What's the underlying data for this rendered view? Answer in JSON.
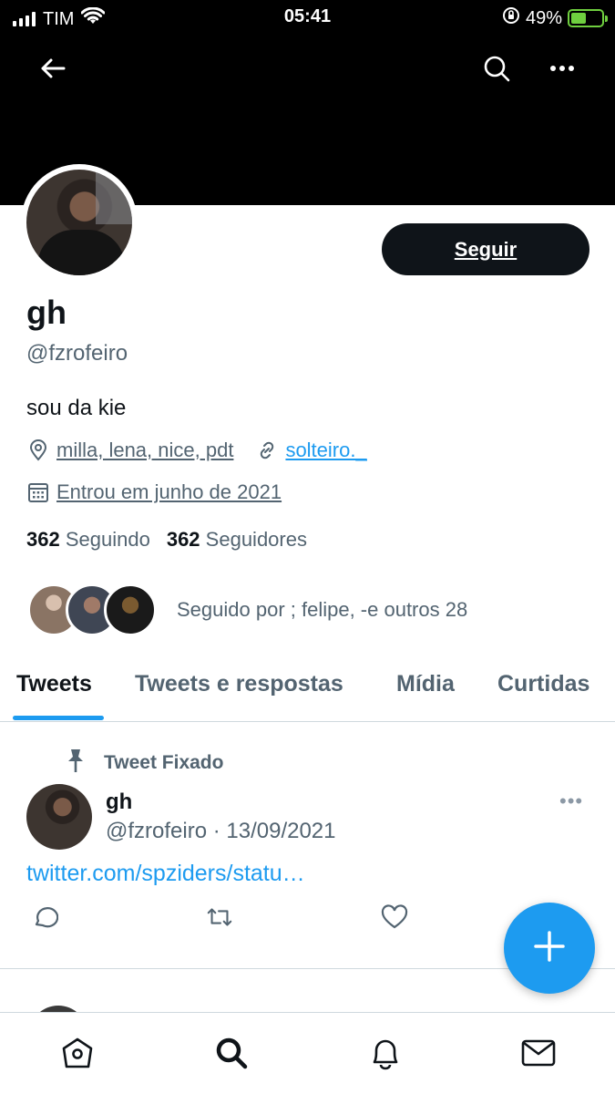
{
  "status_bar": {
    "carrier": "TIM",
    "time": "05:41",
    "battery": "49%"
  },
  "header": {
    "back_icon": "arrow-left-icon",
    "search_icon": "search-icon",
    "more_icon": "more-horizontal-icon"
  },
  "profile": {
    "follow_label": "Seguir",
    "name": "gh",
    "handle": "@fzrofeiro",
    "bio": "sou da kie",
    "location": "milla, lena, nice, pdt",
    "website": "solteiro._",
    "joined": "Entrou em junho de 2021",
    "following_count": "362",
    "following_label": "Seguindo",
    "followers_count": "362",
    "followers_label": "Seguidores",
    "followed_by": "Seguido por ; felipe, ‑e outros 28"
  },
  "tabs": [
    {
      "label": "Tweets",
      "active": true
    },
    {
      "label": "Tweets e respostas",
      "active": false
    },
    {
      "label": "Mídia",
      "active": false
    },
    {
      "label": "Curtidas",
      "active": false
    }
  ],
  "tweet": {
    "pinned_label": "Tweet Fixado",
    "name": "gh",
    "handle_date": "@fzrofeiro · 13/09/2021",
    "more": "•••",
    "link": "twitter.com/spziders/statu…"
  },
  "colors": {
    "accent": "#1d9bf0",
    "text": "#0f1419",
    "muted": "#536471",
    "banner": "#000000"
  }
}
